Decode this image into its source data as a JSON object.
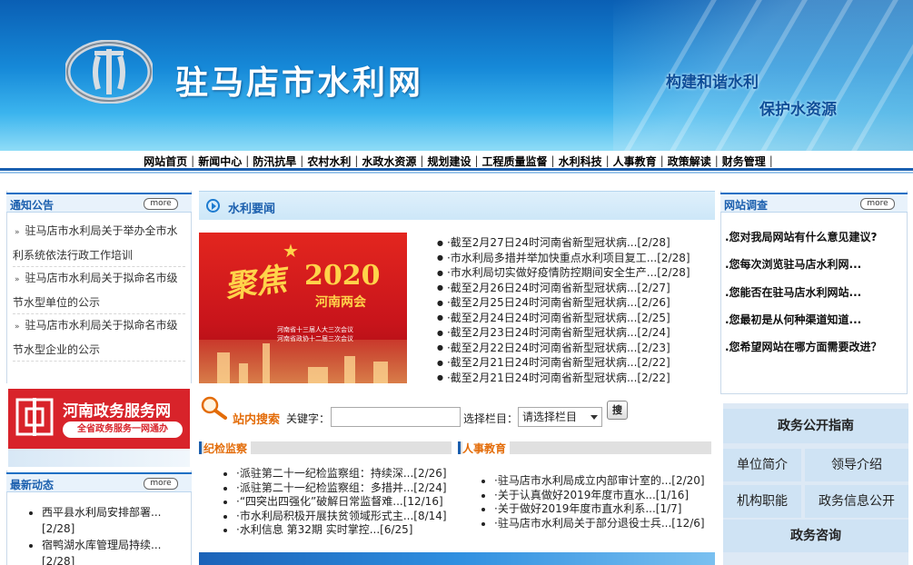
{
  "header": {
    "site_title": "驻马店市水利网",
    "slogan_1": "构建和谐水利",
    "slogan_2": "保护水资源"
  },
  "nav": {
    "items": [
      "网站首页",
      "新闻中心",
      "防汛抗旱",
      "农村水利",
      "水政水资源",
      "规划建设",
      "工程质量监督",
      "水利科技",
      "人事教育",
      "政策解读",
      "财务管理"
    ]
  },
  "notice": {
    "title": "通知公告",
    "more": "more",
    "items": [
      "驻马店市水利局关于举办全市水利系统依法行政工作培训",
      "驻马店市水利局关于拟命名市级节水型单位的公示",
      "驻马店市水利局关于拟命名市级节水型企业的公示"
    ]
  },
  "service_banner": {
    "title": "河南政务服务网",
    "subtitle": "全省政务服务一网通办"
  },
  "latest": {
    "title": "最新动态",
    "more": "more",
    "items": [
      "西平县水利局安排部署...",
      "[2/28]",
      "宿鸭湖水库管理局持续...",
      "[2/28]"
    ]
  },
  "water_news": {
    "title": "水利要闻",
    "photo": {
      "calligraphy": "聚焦",
      "year": "2020",
      "event": "河南两会",
      "line1": "河南省十三届人大三次会议",
      "line2": "河南省政协十二届三次会议"
    },
    "items": [
      "·截至2月27日24时河南省新型冠状病...[2/28]",
      "·市水利局多措并举加快重点水利项目复工...[2/28]",
      "·市水利局切实做好疫情防控期间安全生产...[2/28]",
      "·截至2月26日24时河南省新型冠状病...[2/27]",
      "·截至2月25日24时河南省新型冠状病...[2/26]",
      "·截至2月24日24时河南省新型冠状病...[2/25]",
      "·截至2月23日24时河南省新型冠状病...[2/24]",
      "·截至2月22日24时河南省新型冠状病...[2/23]",
      "·截至2月21日24时河南省新型冠状病...[2/22]",
      "·截至2月21日24时河南省新型冠状病...[2/22]"
    ]
  },
  "search": {
    "label": "站内搜索",
    "keyword_label": "关键字：",
    "keyword_value": "",
    "column_label": "选择栏目：",
    "column_selected": "请选择栏目",
    "button": "搜"
  },
  "discipline": {
    "title": "纪检监察",
    "items": [
      "·派驻第二十一纪检监察组：持续深...[2/26]",
      "·派驻第二十一纪检监察组：多措并...[2/24]",
      "·“四突出四强化”破解日常监督难...[12/16]",
      "·市水利局积极开展扶贫领域形式主...[8/14]",
      "·水利信息 第32期 实时掌控...[6/25]"
    ]
  },
  "personnel": {
    "title": "人事教育",
    "items": [
      "·驻马店市水利局成立内部审计室的...[2/20]",
      "·关于认真做好2019年度市直水...[1/16]",
      "·关于做好2019年度市直水利系...[1/7]",
      "·驻马店市水利局关于部分退役士兵...[12/6]"
    ]
  },
  "survey": {
    "title": "网站调查",
    "more": "more",
    "items": [
      ".您对我局网站有什么意见建议?",
      ".您每次浏览驻马店水利网...",
      ".您能否在驻马店水利网站...",
      ".您最初是从何种渠道知道...",
      ".您希望网站在哪方面需要改进？"
    ]
  },
  "gov": {
    "guide": "政务公开指南",
    "unit_intro": "单位简介",
    "leader_intro": "领导介绍",
    "functions": "机构职能",
    "info_public": "政务信息公开",
    "consult": "政务咨询"
  },
  "colors": {
    "brand_blue": "#1b5fae",
    "accent_orange": "#e36c09",
    "banner_red": "#d8232a"
  }
}
